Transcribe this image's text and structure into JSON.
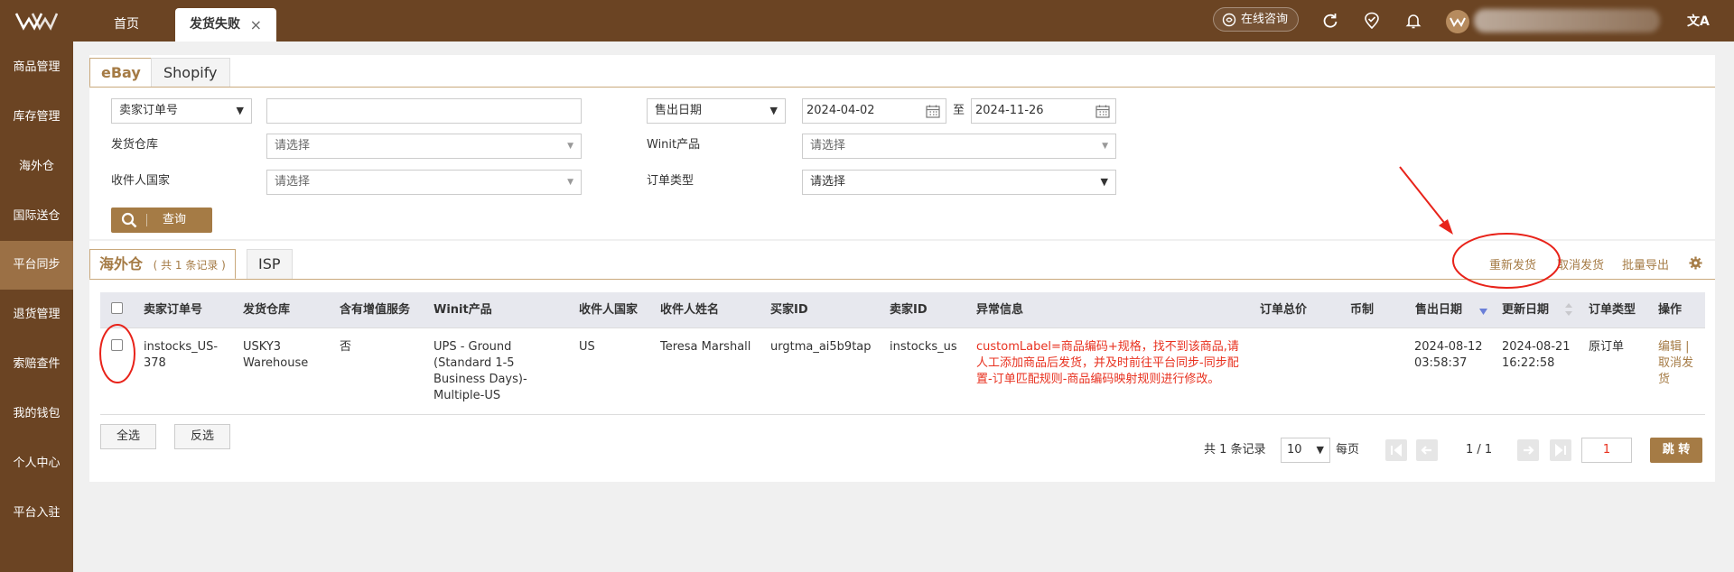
{
  "header": {
    "tabs": [
      {
        "label": "首页"
      },
      {
        "label": "发货失败",
        "close": "×"
      }
    ],
    "consult_label": "在线咨询",
    "lang_icon": "文A"
  },
  "sidebar": {
    "items": [
      {
        "label": "商品管理"
      },
      {
        "label": "库存管理"
      },
      {
        "label": "海外仓"
      },
      {
        "label": "国际送仓"
      },
      {
        "label": "平台同步"
      },
      {
        "label": "退货管理"
      },
      {
        "label": "索赔查件"
      },
      {
        "label": "我的钱包"
      },
      {
        "label": "个人中心"
      },
      {
        "label": "平台入驻"
      }
    ],
    "active_index": 4
  },
  "platform_tabs": [
    {
      "label": "eBay"
    },
    {
      "label": "Shopify"
    }
  ],
  "filters": {
    "order_type_select": "卖家订单号",
    "order_no_value": "",
    "date_type_select": "售出日期",
    "date_from": "2024-04-02",
    "date_to_sep": "至",
    "date_to": "2024-11-26",
    "warehouse_label": "发货仓库",
    "warehouse_ph": "请选择",
    "winit_label": "Winit产品",
    "winit_ph": "请选择",
    "country_label": "收件人国家",
    "country_ph": "请选择",
    "ordertype_label": "订单类型",
    "ordertype_ph": "请选择",
    "query_label": "查询"
  },
  "result_tabs": {
    "overseas_label": "海外仓",
    "overseas_count": "( 共 1 条记录 )",
    "isp_label": "ISP"
  },
  "toolbar": {
    "resend": "重新发货",
    "cancel": "取消发货",
    "export": "批量导出"
  },
  "table": {
    "columns": [
      "卖家订单号",
      "发货仓库",
      "含有增值服务",
      "Winit产品",
      "收件人国家",
      "收件人姓名",
      "买家ID",
      "卖家ID",
      "异常信息",
      "订单总价",
      "币制",
      "售出日期",
      "更新日期",
      "订单类型",
      "操作"
    ],
    "rows": [
      {
        "seller_order": "instocks_US-378",
        "warehouse": "USKY3 Warehouse",
        "value_added": "否",
        "winit_product": "UPS - Ground (Standard 1-5 Business Days)-Multiple-US",
        "country": "US",
        "recipient": "Teresa Marshall",
        "buyer_id": "urgtma_ai5b9tap",
        "seller_id": "instocks_us",
        "error": "customLabel=商品编码+规格，找不到该商品,请人工添加商品后发货，并及时前往平台同步-同步配置-订单匹配规则-商品编码映射规则进行修改。",
        "total": "",
        "currency": "",
        "sold_date": "2024-08-12 03:58:37",
        "updated_date": "2024-08-21 16:22:58",
        "order_type": "原订单",
        "op_edit": "编辑",
        "op_sep": "|",
        "op_cancel": "取消发货"
      }
    ]
  },
  "footer": {
    "select_all": "全选",
    "invert": "反选",
    "total_text": "共 1 条记录",
    "page_size": "10",
    "per_page": "每页",
    "page_info": "1 / 1",
    "page_input": "1",
    "jump": "跳 转"
  },
  "colors": {
    "brand_dark": "#6b4423",
    "accent": "#a57b45",
    "error": "#e8311f",
    "annotation": "#e8231a"
  }
}
